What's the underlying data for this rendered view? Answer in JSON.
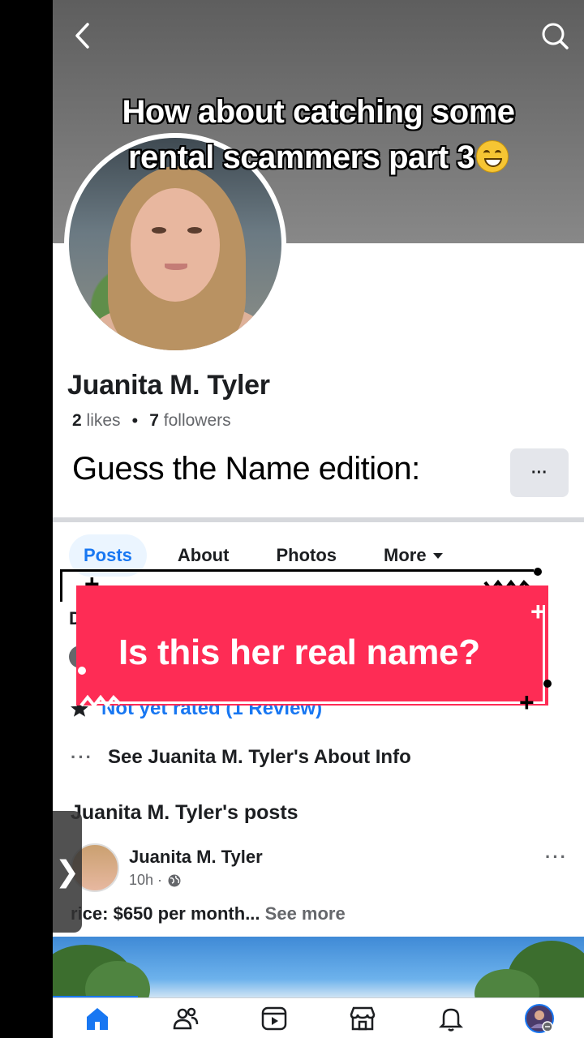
{
  "video": {
    "caption_line1": "How about catching some",
    "caption_line2": "rental scammers part 3",
    "caption_emoji": "grinning-face-emoji",
    "overlay_text": "Is this her real name?",
    "overlay_color": "#fe2c55",
    "guess_text": "Guess the Name edition:"
  },
  "profile": {
    "name": "Juanita M. Tyler",
    "likes_count": "2",
    "likes_label": "likes",
    "followers_count": "7",
    "followers_label": "followers",
    "more_button": "···"
  },
  "tabs": [
    {
      "label": "Posts",
      "active": true
    },
    {
      "label": "About"
    },
    {
      "label": "Photos"
    },
    {
      "label": "More"
    }
  ],
  "details": {
    "partial_heading": "D",
    "rating_text": "Not yet rated (1 Review)",
    "about_ellipsis": "···",
    "about_link": "See Juanita M. Tyler's About Info"
  },
  "posts": {
    "heading": "Juanita M. Tyler's posts",
    "author": "Juanita M. Tyler",
    "time": "10h ·",
    "menu": "···",
    "text": "rice: $650 per month...",
    "see_more": "See more"
  },
  "side_handle": "❯",
  "nav": [
    {
      "icon": "home-icon",
      "active": true
    },
    {
      "icon": "friends-icon"
    },
    {
      "icon": "video-icon"
    },
    {
      "icon": "marketplace-icon"
    },
    {
      "icon": "notifications-icon"
    },
    {
      "icon": "profile-icon"
    }
  ],
  "colors": {
    "facebook_blue": "#1877f2",
    "text_primary": "#1c1e21",
    "text_secondary": "#65676b"
  }
}
